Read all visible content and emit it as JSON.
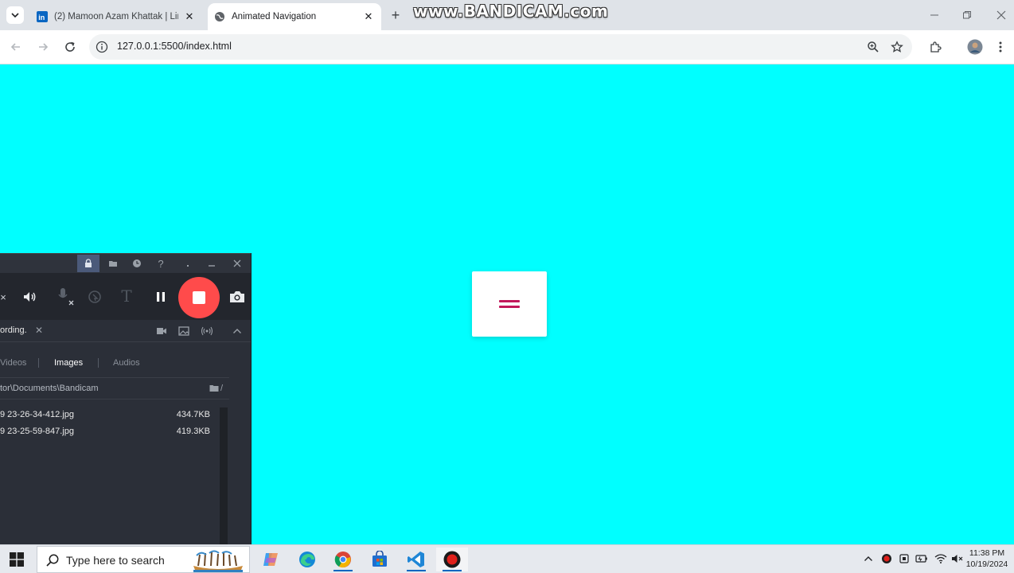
{
  "browser": {
    "tabs": [
      {
        "title": "(2) Mamoon Azam Khattak | Lin",
        "favicon": "linkedin-icon",
        "active": false
      },
      {
        "title": "Animated Navigation",
        "favicon": "globe-icon",
        "active": true
      }
    ],
    "new_tab_label": "+",
    "url": "127.0.0.1:5500/index.html",
    "watermark": "www.BANDICAM.com"
  },
  "page": {
    "background": "#00ffff",
    "menu_button_icon": "hamburger-icon",
    "menu_color": "#c2185b"
  },
  "bandicam": {
    "status_text": "ording.",
    "tabs": [
      "Videos",
      "Images",
      "Audios"
    ],
    "active_tab": "Images",
    "path": "tor\\Documents\\Bandicam",
    "path_suffix": "/",
    "files": [
      {
        "name": "9 23-26-34-412.jpg",
        "size": "434.7KB"
      },
      {
        "name": "9 23-25-59-847.jpg",
        "size": "419.3KB"
      }
    ],
    "record_color": "#ff4b4b"
  },
  "taskbar": {
    "search_placeholder": "Type here to search",
    "pinned": [
      "copilot-icon",
      "edge-icon",
      "chrome-icon",
      "store-icon",
      "vscode-icon",
      "bandicam-icon"
    ],
    "time": "11:38 PM",
    "date": "10/19/2024"
  }
}
